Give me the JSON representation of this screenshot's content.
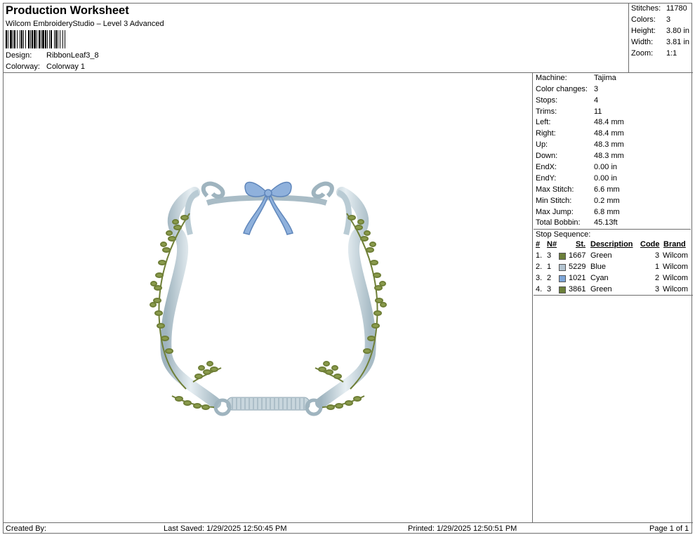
{
  "header": {
    "title": "Production Worksheet",
    "subtitle": "Wilcom EmbroideryStudio – Level 3 Advanced",
    "design_label": "Design:",
    "design_value": "RibbonLeaf3_8",
    "colorway_label": "Colorway:",
    "colorway_value": "Colorway 1"
  },
  "summary": [
    {
      "label": "Stitches:",
      "value": "11780"
    },
    {
      "label": "Colors:",
      "value": "3"
    },
    {
      "label": "Height:",
      "value": "3.80 in"
    },
    {
      "label": "Width:",
      "value": "3.81 in"
    },
    {
      "label": "Zoom:",
      "value": "1:1"
    }
  ],
  "machine_info": [
    {
      "label": "Machine:",
      "value": "Tajima"
    },
    {
      "label": "Color changes:",
      "value": "3"
    },
    {
      "label": "Stops:",
      "value": "4"
    },
    {
      "label": "Trims:",
      "value": "11"
    },
    {
      "label": "Left:",
      "value": "48.4 mm"
    },
    {
      "label": "Right:",
      "value": "48.4 mm"
    },
    {
      "label": "Up:",
      "value": "48.3 mm"
    },
    {
      "label": "Down:",
      "value": "48.3 mm"
    },
    {
      "label": "EndX:",
      "value": "0.00 in"
    },
    {
      "label": "EndY:",
      "value": "0.00 in"
    },
    {
      "label": "Max Stitch:",
      "value": "6.6 mm"
    },
    {
      "label": "Min Stitch:",
      "value": "0.2 mm"
    },
    {
      "label": "Max Jump:",
      "value": "6.8 mm"
    },
    {
      "label": "Total Bobbin:",
      "value": "45.13ft"
    }
  ],
  "stop_sequence": {
    "title": "Stop Sequence:",
    "columns": [
      "#",
      "N#",
      "St.",
      "Description",
      "Code",
      "Brand"
    ],
    "rows": [
      {
        "num": "1.",
        "n": "3",
        "color": "#6b7f3a",
        "st": "1667",
        "desc": "Green",
        "code": "3",
        "brand": "Wilcom"
      },
      {
        "num": "2.",
        "n": "1",
        "color": "#b3c4d0",
        "st": "5229",
        "desc": "Blue",
        "code": "1",
        "brand": "Wilcom"
      },
      {
        "num": "3.",
        "n": "2",
        "color": "#7ea6d8",
        "st": "1021",
        "desc": "Cyan",
        "code": "2",
        "brand": "Wilcom"
      },
      {
        "num": "4.",
        "n": "3",
        "color": "#6b7f3a",
        "st": "3861",
        "desc": "Green",
        "code": "3",
        "brand": "Wilcom"
      }
    ]
  },
  "footer": {
    "created": "Created By:",
    "saved": "Last Saved: 1/29/2025 12:50:45 PM",
    "printed": "Printed: 1/29/2025 12:50:51 PM",
    "page": "Page 1 of 1"
  },
  "colors": {
    "frame": "#b9cbd4",
    "frame_shade": "#8fa6b2",
    "leaf": "#8a9b4c",
    "stem": "#6f7f37",
    "bow": "#8fb1dc"
  }
}
